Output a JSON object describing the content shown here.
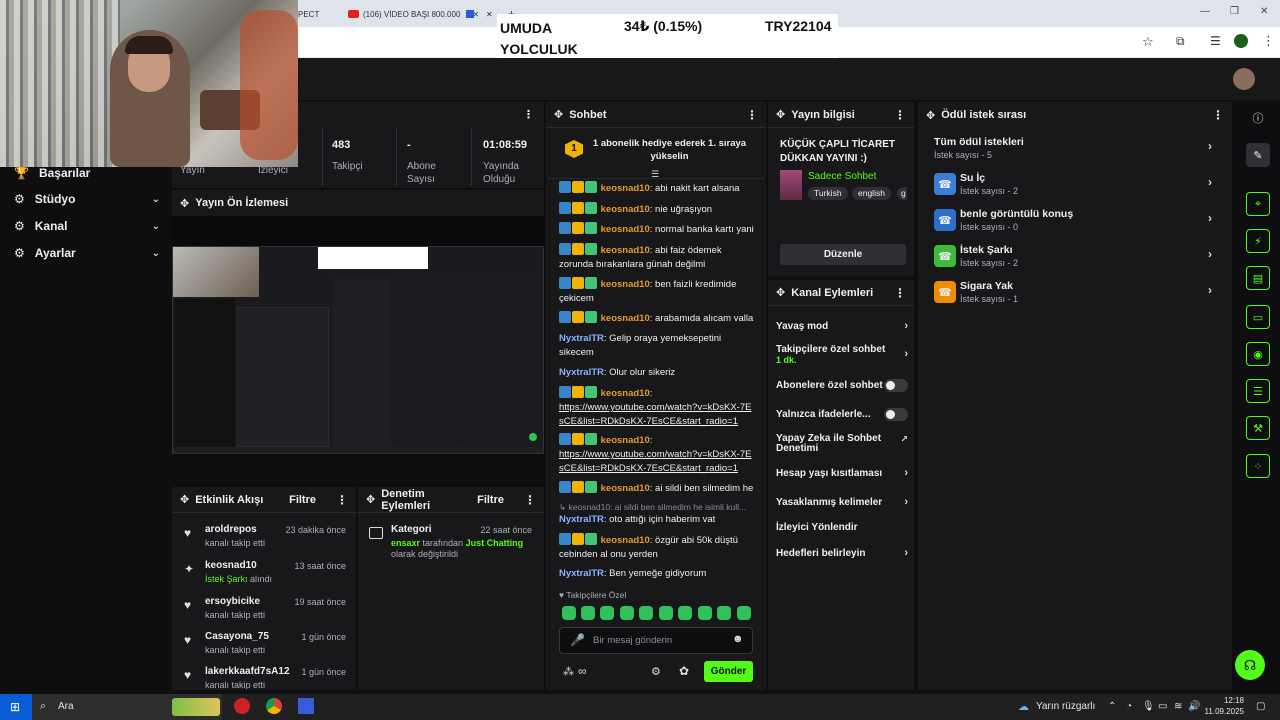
{
  "browser": {
    "tabs": [
      {
        "label": "PECT"
      },
      {
        "label": "(106) VİDEO BAŞI 800.000"
      }
    ],
    "new_tab": "+"
  },
  "ticker": {
    "left": "UMUDA YOLCULUK",
    "mid": "34₺ (0.15%)",
    "right": "TRY22104"
  },
  "left_nav": {
    "items": [
      {
        "label": "Başarılar",
        "icon": "trophy-icon"
      },
      {
        "label": "Stüdyo",
        "icon": "gear-icon"
      },
      {
        "label": "Kanal",
        "icon": "gear-icon"
      },
      {
        "label": "Ayarlar",
        "icon": "gear-icon"
      }
    ]
  },
  "stats": {
    "yayin_label": "Yayın",
    "izleyici_label": "İzleyici",
    "takipci_value": "483",
    "takipci_label": "Takipçi",
    "abone_value": "-",
    "abone_label1": "Abone",
    "abone_label2": "Sayısı",
    "uptime_value": "01:08:59",
    "uptime_label1": "Yayında",
    "uptime_label2": "Olduğu"
  },
  "preview": {
    "title": "Yayın Ön İzlemesi"
  },
  "chat": {
    "title": "Sohbet",
    "pinned_count": "1",
    "pinned_text": "1 abonelik hediye ederek 1. sıraya yükselin",
    "messages": [
      {
        "user": "keosnad10",
        "text": ": abi nakit kart alsana"
      },
      {
        "user": "keosnad10",
        "text": ": nie uğraşıyon"
      },
      {
        "user": "keosnad10",
        "text": ": normal banka kartı yani"
      },
      {
        "user": "keosnad10",
        "text": ": abi faiz ödemek zorunda bırakanlara günah değilmi"
      },
      {
        "user": "keosnad10",
        "text": ": ben faizli kredimide çekicem"
      },
      {
        "user": "keosnad10",
        "text": ": arabamıda alıcam valla"
      },
      {
        "user": "NyxtralTR",
        "text": ": Gelip oraya yemeksepetini sikecem"
      },
      {
        "user": "NyxtralTR",
        "text": ": Olur olur sikeriz"
      },
      {
        "user": "keosnad10",
        "text": ":",
        "link": "https://www.youtube.com/watch?v=kDsKX-7EsCE&list=RDkDsKX-7EsCE&start_radio=1"
      },
      {
        "user": "keosnad10",
        "text": ":",
        "link": "https://www.youtube.com/watch?v=kDsKX-7EsCE&list=RDkDsKX-7EsCE&start_radio=1"
      },
      {
        "user": "keosnad10",
        "text": ": ai sildi ben silmedim he"
      },
      {
        "user": "NyxtralTR",
        "text": ": oto attığı için haberim vat"
      },
      {
        "user": "keosnad10",
        "text": ": özgür abi 50k düştü cebinden al onu yerden"
      },
      {
        "user": "NyxtralTR",
        "text": ": Ben yemeğe gidiyorum"
      }
    ],
    "reply_text": "keosnad10: ai sildi ben silmedim he isimli kull...",
    "followers_only": "Takipçilere Özel",
    "input_placeholder": "Bir mesaj gönderin",
    "points": "∞",
    "send_label": "Gönder"
  },
  "stream_info": {
    "title": "Yayın bilgisi",
    "stream_title": "KÜÇÜK ÇAPLI TİCARET DÜKKAN YAYINI :)",
    "category": "Sadece Sohbet",
    "tags": [
      "Turkish",
      "english",
      "g"
    ],
    "edit_label": "Düzenle"
  },
  "channel_actions": {
    "title": "Kanal Eylemleri",
    "rows": [
      {
        "label": "Yavaş mod"
      },
      {
        "label": "Takipçilere özel sohbet",
        "sub": "1 dk."
      },
      {
        "label": "Abonelere özel sohbet"
      },
      {
        "label": "Yalnızca ifadelerle..."
      },
      {
        "label": "Yapay Zeka ile Sohbet Denetimi"
      },
      {
        "label": "Hesap yaşı kısıtlaması"
      },
      {
        "label": "Yasaklanmış kelimeler"
      },
      {
        "label": "İzleyici Yönlendir"
      },
      {
        "label": "Hedefleri belirleyin"
      }
    ]
  },
  "rewards": {
    "title": "Ödül istek sırası",
    "all_title": "Tüm ödül istekleri",
    "all_sub": "İstek sayısı - 5",
    "items": [
      {
        "title": "Su İç",
        "sub": "İstek sayısı - 2",
        "color": "#3b7dd8"
      },
      {
        "title": "benle görüntülü konuş",
        "sub": "İstek sayısı - 0",
        "color": "#2b6fc9"
      },
      {
        "title": "İstek Şarkı",
        "sub": "İstek sayısı - 2",
        "color": "#3dbb3d"
      },
      {
        "title": "Sigara Yak",
        "sub": "İstek sayısı - 1",
        "color": "#f08c00"
      }
    ]
  },
  "activity": {
    "title": "Etkinlik Akışı",
    "filter": "Filtre",
    "items": [
      {
        "name": "aroldrepos",
        "desc": "kanalı takip etti",
        "time": "23 dakika önce"
      },
      {
        "name": "keosnad10",
        "desc": "İstek Şarkı",
        "desc2": "alındı",
        "time": "13 saat önce"
      },
      {
        "name": "ersoybicike",
        "desc": "kanalı takip etti",
        "time": "19 saat önce"
      },
      {
        "name": "Casayona_75",
        "desc": "kanalı takip etti",
        "time": "1 gün önce"
      },
      {
        "name": "lakerkkaafd7sA12",
        "desc": "kanalı takip etti",
        "time": "1 gün önce"
      }
    ]
  },
  "moderation": {
    "title": "Denetim Eylemleri",
    "filter": "Filtre",
    "item_title": "Kategori",
    "item_time": "22 saat önce",
    "item_user": "ensaxr",
    "item_mid": " tarafından ",
    "item_cat": "Just Chatting",
    "item_tail": "olarak değiştirildi"
  },
  "taskbar": {
    "search": "Ara",
    "weather": "Yarın rüzgarlı",
    "time": "12:18",
    "date": "11.09.2025"
  },
  "colors": {
    "accent": "#53fc18",
    "panel": "#18181b",
    "bg": "#0e0e10"
  }
}
